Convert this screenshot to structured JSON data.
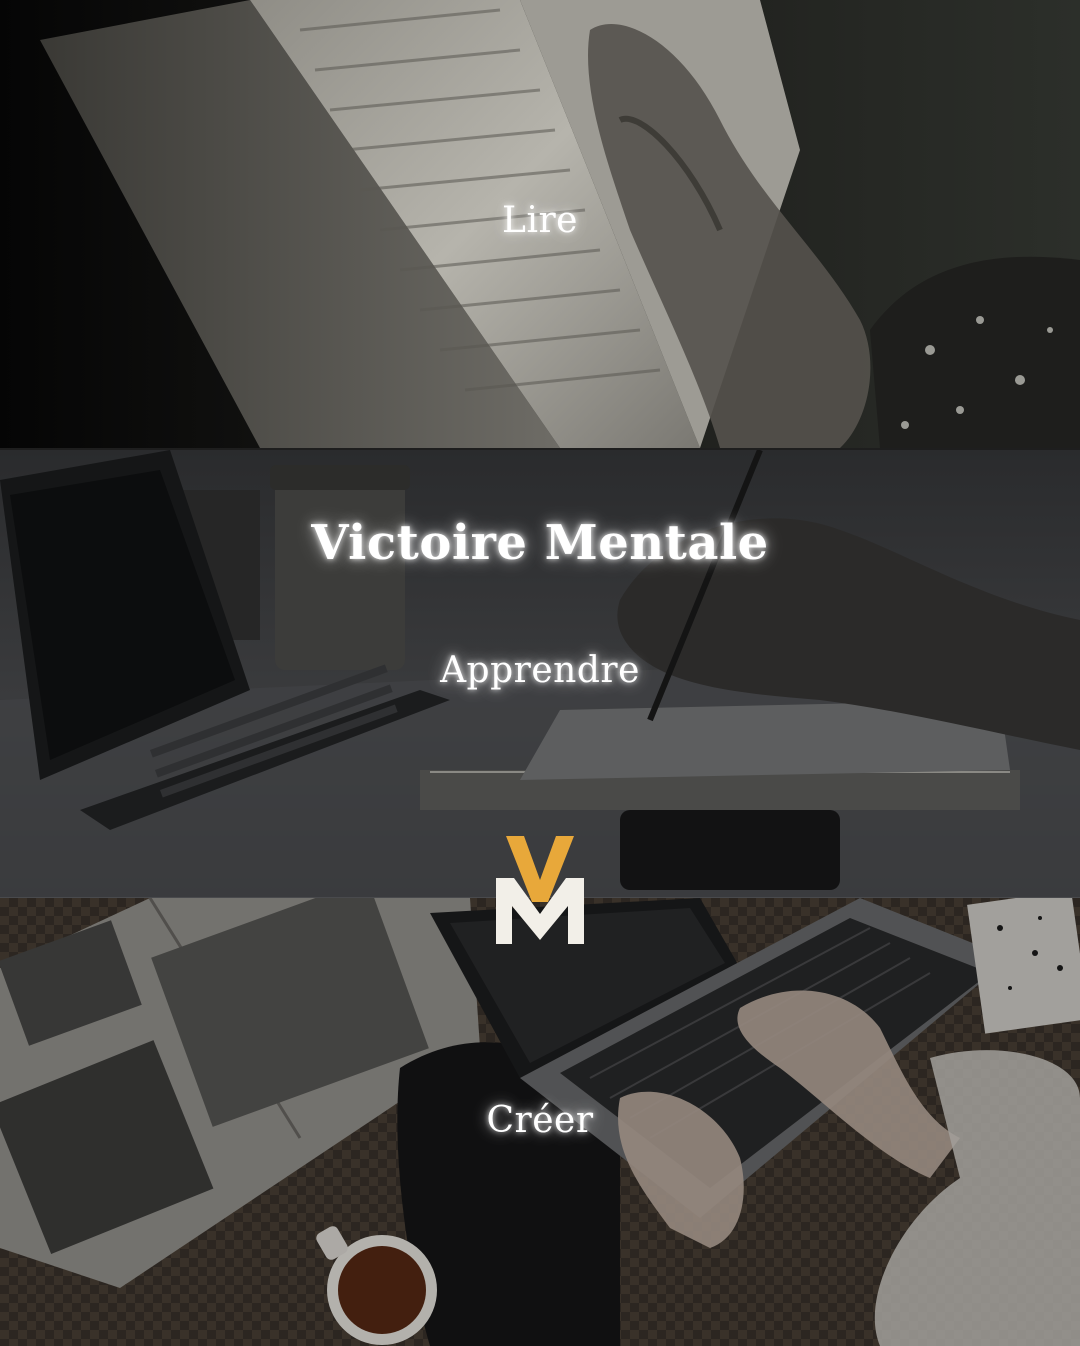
{
  "panels": {
    "top": {
      "label": "Lire"
    },
    "middle": {
      "label": "Apprendre"
    },
    "bottom": {
      "label": "Créer"
    }
  },
  "brand": {
    "title": "Victoire Mentale",
    "logo_letters": "VM"
  },
  "colors": {
    "accent_gold": "#E8A83A",
    "logo_white": "#F2EFE8",
    "text_glow": "#FFFFFF"
  },
  "icons": {
    "logo": "vm-monogram-logo"
  }
}
